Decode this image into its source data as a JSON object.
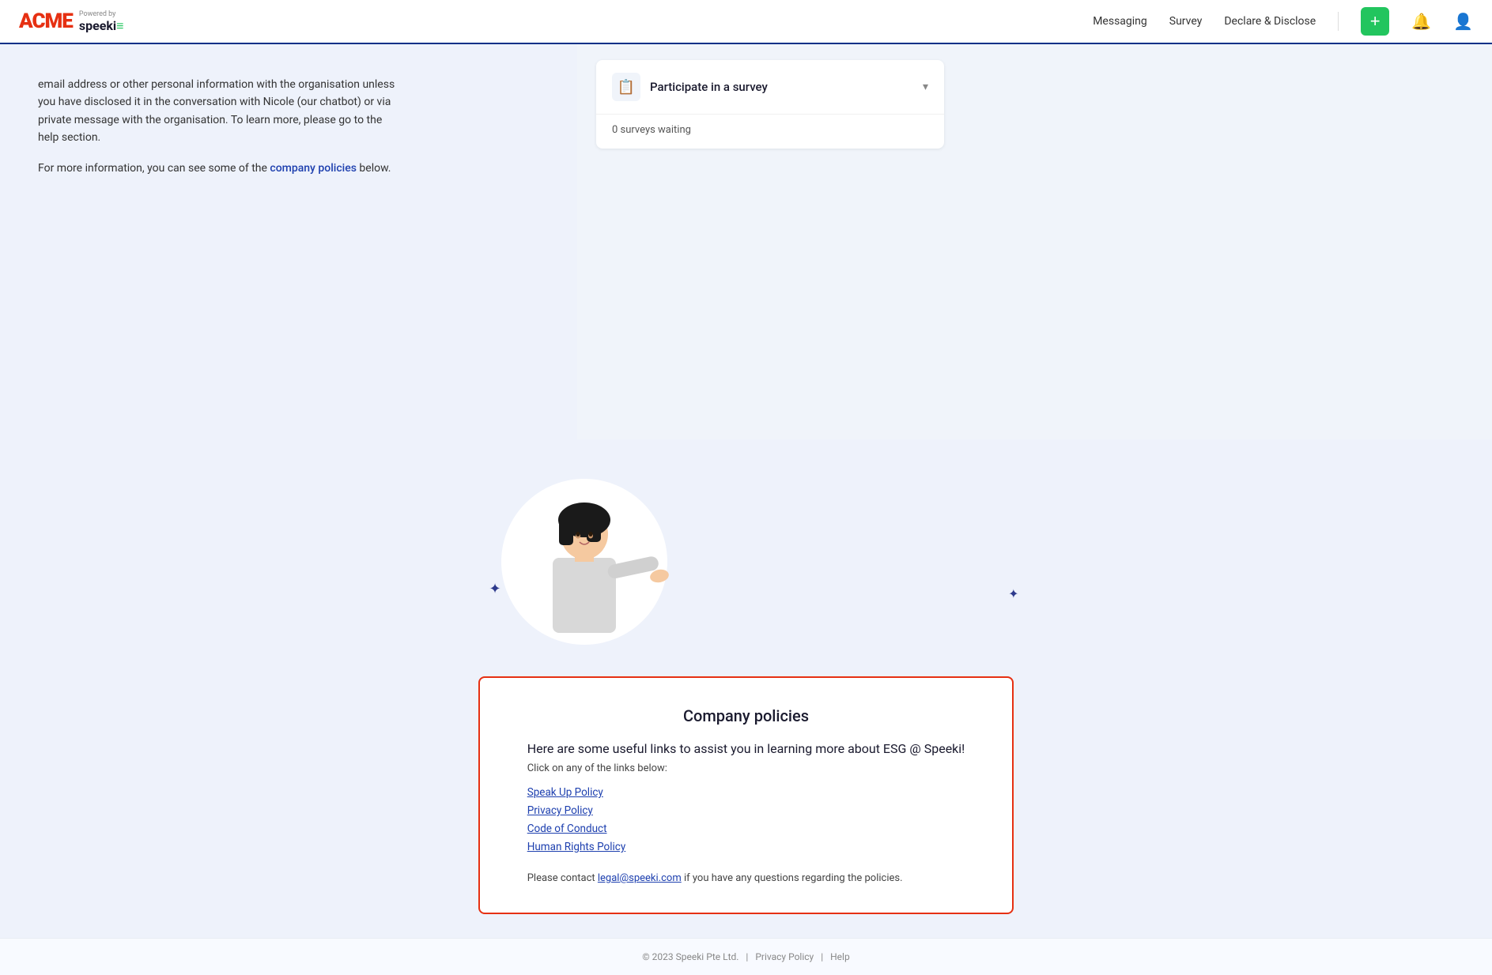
{
  "header": {
    "acme_label": "ACME",
    "powered_by": "Powered by",
    "speeki_label": "speeki",
    "nav": {
      "messaging": "Messaging",
      "survey": "Survey",
      "declare_disclose": "Declare & Disclose"
    },
    "plus_button_label": "+"
  },
  "intro": {
    "paragraph1": "email address or other personal information with the organisation unless you have disclosed it in the conversation with Nicole (our chatbot) or via private message with the organisation. To learn more, please go to the help section.",
    "paragraph2_prefix": "For more information, you can see some of the ",
    "policies_link_text": "company policies",
    "paragraph2_suffix": " below."
  },
  "survey_card": {
    "title": "Participate in a survey",
    "count_text": "0 surveys waiting"
  },
  "policies": {
    "title": "Company policies",
    "subtitle": "Here are some useful links to assist you in learning more about ESG @ Speeki!",
    "instruction": "Click on any of the links below:",
    "links": [
      {
        "label": "Speak Up Policy",
        "url": "#"
      },
      {
        "label": "Privacy Policy",
        "url": "#"
      },
      {
        "label": "Code of Conduct",
        "url": "#"
      },
      {
        "label": "Human Rights Policy",
        "url": "#"
      }
    ],
    "contact_prefix": "Please contact ",
    "contact_email": "legal@speeki.com",
    "contact_suffix": " if you have any questions regarding the policies."
  },
  "footer": {
    "copyright": "© 2023 Speeki Pte Ltd.",
    "privacy_policy": "Privacy Policy",
    "help": "Help"
  }
}
